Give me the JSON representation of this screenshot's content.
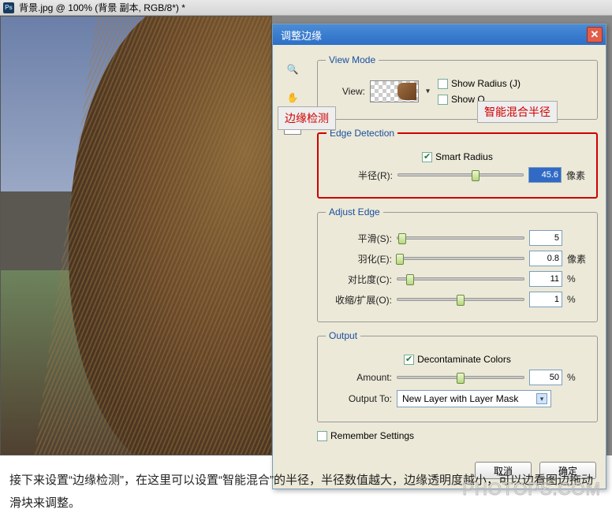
{
  "titlebar": {
    "text": "背景.jpg @ 100% (背景 副本, RGB/8*) *"
  },
  "dialog": {
    "title": "调整边缘",
    "viewMode": {
      "legend": "View Mode",
      "viewLabel": "View:",
      "showRadius": "Show Radius (J)",
      "showOriginalPartial": "Show O"
    },
    "edgeDetection": {
      "legend": "Edge Detection",
      "smartRadius": "Smart Radius",
      "radiusLabel": "半径(R):",
      "radiusValue": "45.6",
      "radiusUnit": "像素",
      "thumbPos": "62%"
    },
    "adjustEdge": {
      "legend": "Adjust Edge",
      "smooth": {
        "label": "平滑(S):",
        "value": "5",
        "pos": "4%"
      },
      "feather": {
        "label": "羽化(E):",
        "value": "0.8",
        "unit": "像素",
        "pos": "2%"
      },
      "contrast": {
        "label": "对比度(C):",
        "value": "11",
        "unit": "%",
        "pos": "10%"
      },
      "shift": {
        "label": "收缩/扩展(O):",
        "value": "1",
        "unit": "%",
        "pos": "50%"
      }
    },
    "output": {
      "legend": "Output",
      "decontaminate": "Decontaminate Colors",
      "amountLabel": "Amount:",
      "amountValue": "50",
      "amountUnit": "%",
      "amountPos": "50%",
      "outputToLabel": "Output To:",
      "outputToValue": "New Layer with Layer Mask"
    },
    "remember": "Remember Settings",
    "cancel": "取消",
    "ok": "确定"
  },
  "callouts": {
    "edge": "边缘检测",
    "smart": "智能混合半径"
  },
  "caption": "接下来设置“边缘检测”，在这里可以设置“智能混合”的半径，半径数值越大，边缘透明度越小，可以边看图边拖动滑块来调整。",
  "watermark": "PHOTOPS.COM"
}
